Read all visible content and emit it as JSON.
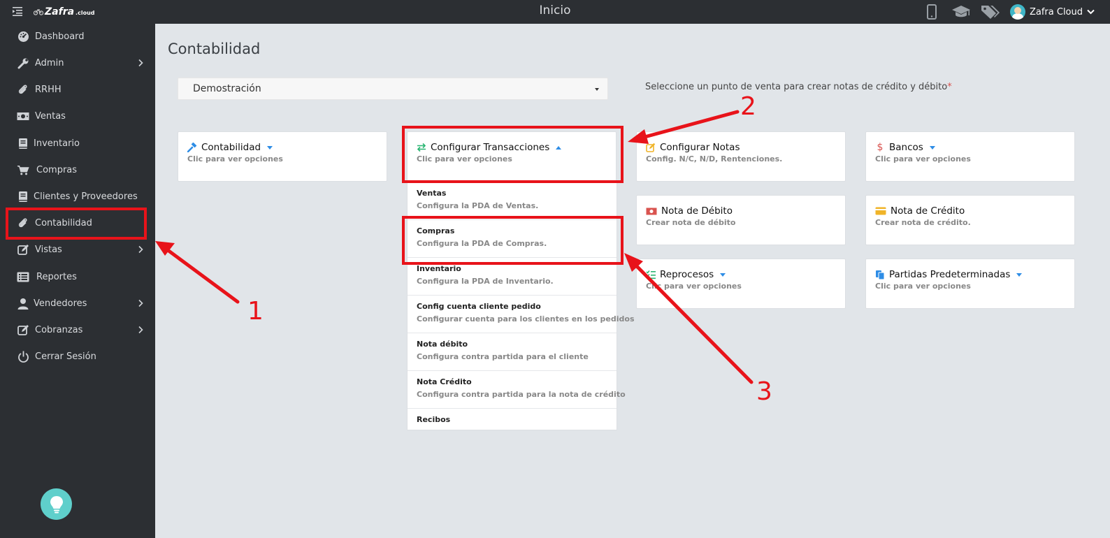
{
  "topbar": {
    "brand_name": "Zafra",
    "brand_suffix": ".cloud",
    "title": "Inicio",
    "user_name": "Zafra Cloud"
  },
  "sidebar": {
    "items": [
      {
        "label": "Dashboard",
        "icon": "dashboard-icon"
      },
      {
        "label": "Admin",
        "icon": "wrench-icon",
        "has_submenu": true
      },
      {
        "label": "RRHH",
        "icon": "paperclip-icon"
      },
      {
        "label": "Ventas",
        "icon": "money-icon"
      },
      {
        "label": "Inventario",
        "icon": "book-icon"
      },
      {
        "label": "Compras",
        "icon": "cart-icon"
      },
      {
        "label": "Clientes y Proveedores",
        "icon": "book-icon"
      },
      {
        "label": "Contabilidad",
        "icon": "paperclip-icon"
      },
      {
        "label": "Vistas",
        "icon": "edit-icon",
        "has_submenu": true
      },
      {
        "label": "Reportes",
        "icon": "list-icon"
      },
      {
        "label": "Vendedores",
        "icon": "user-icon",
        "has_submenu": true
      },
      {
        "label": "Cobranzas",
        "icon": "edit-icon",
        "has_submenu": true
      },
      {
        "label": "Cerrar Sesión",
        "icon": "power-icon"
      }
    ]
  },
  "main": {
    "title": "Contabilidad",
    "pos_select": {
      "value": "Demostración"
    },
    "pos_hint": "Seleccione un punto de venta para crear notas de crédito y débito",
    "pos_hint_required": "*",
    "cards": {
      "contabilidad": {
        "title": "Contabilidad",
        "subtitle": "Clic para ver opciones"
      },
      "configurar_transacciones": {
        "title": "Configurar Transacciones",
        "subtitle": "Clic para ver opciones"
      },
      "configurar_notas": {
        "title": "Configurar Notas",
        "subtitle": "Config. N/C, N/D, Rentenciones."
      },
      "bancos": {
        "title": "Bancos",
        "subtitle": "Clic para ver opciones"
      },
      "nota_debito": {
        "title": "Nota de Débito",
        "subtitle": "Crear nota de débito"
      },
      "nota_credito": {
        "title": "Nota de Crédito",
        "subtitle": "Crear nota de crédito."
      },
      "reprocesos": {
        "title": "Reprocesos",
        "subtitle": "Clic para ver opciones"
      },
      "partidas": {
        "title": "Partidas Predeterminadas",
        "subtitle": "Clic para ver opciones"
      }
    },
    "transacciones_menu": [
      {
        "title": "Ventas",
        "desc": "Configura la PDA de Ventas."
      },
      {
        "title": "Compras",
        "desc": "Configura la PDA de Compras."
      },
      {
        "title": "Inventario",
        "desc": "Configura la PDA de Inventario."
      },
      {
        "title": "Config cuenta cliente pedido",
        "desc": "Configurar cuenta para los clientes en los pedidos"
      },
      {
        "title": "Nota débito",
        "desc": "Configura contra partida para el cliente"
      },
      {
        "title": "Nota Crédito",
        "desc": "Configura contra partida para la nota de crédito"
      },
      {
        "title": "Recibos",
        "desc": ""
      }
    ]
  },
  "annotations": {
    "labels": [
      "1",
      "2",
      "3"
    ],
    "color": "#e8131a"
  },
  "colors": {
    "sidebar_bg": "#2c2f33",
    "page_bg": "#e1e5e9",
    "accent_blue": "#2e8de6",
    "bulb": "#5fcfcb"
  }
}
